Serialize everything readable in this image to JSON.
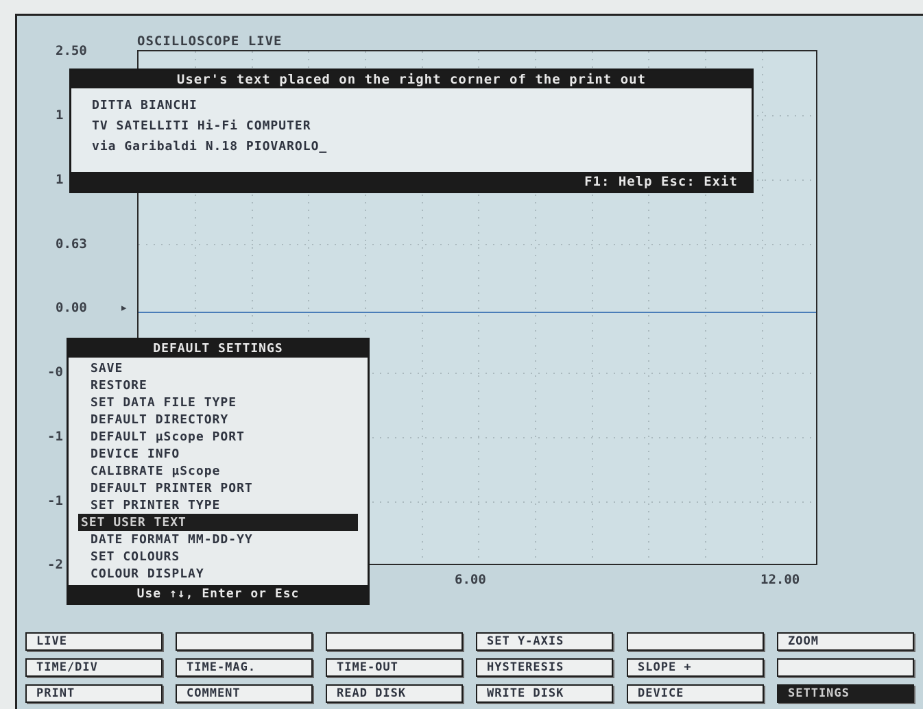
{
  "plot": {
    "title": "OSCILLOSCOPE LIVE",
    "y_labels": [
      {
        "key": "top",
        "text": "2.50"
      },
      {
        "key": "a",
        "text": "1"
      },
      {
        "key": "b",
        "text": "1"
      },
      {
        "key": "c",
        "text": "0.63"
      },
      {
        "key": "zero",
        "text": "0.00"
      },
      {
        "key": "d",
        "text": "-0"
      },
      {
        "key": "e",
        "text": "-1"
      },
      {
        "key": "f",
        "text": "-1"
      },
      {
        "key": "g",
        "text": "-2"
      }
    ],
    "x_labels": [
      "6.00",
      "12.00"
    ],
    "zero_marker": "▸"
  },
  "user_text_dialog": {
    "title": "User's text placed on the right corner of the print out",
    "lines": [
      "DITTA BIANCHI",
      "TV SATELLITI Hi-Fi COMPUTER",
      "via Garibaldi N.18 PIOVAROLO_"
    ],
    "footer": "F1: Help  Esc: Exit"
  },
  "settings_menu": {
    "title": "DEFAULT SETTINGS",
    "items": [
      "SAVE",
      "RESTORE",
      "SET DATA FILE TYPE",
      "DEFAULT DIRECTORY",
      "DEFAULT µScope PORT",
      "DEVICE INFO",
      "CALIBRATE µScope",
      "DEFAULT PRINTER PORT",
      "SET PRINTER TYPE",
      "SET USER TEXT",
      "DATE FORMAT MM-DD-YY",
      "SET COLOURS",
      "COLOUR DISPLAY"
    ],
    "selected_index": 9,
    "footer": "Use ↑↓, Enter or Esc"
  },
  "function_keys": {
    "rows": [
      [
        "LIVE",
        "",
        "",
        "SET Y-AXIS",
        "",
        "ZOOM"
      ],
      [
        "TIME/DIV",
        "TIME-MAG.",
        "TIME-OUT",
        "HYSTERESIS",
        "SLOPE +",
        ""
      ],
      [
        "PRINT",
        "COMMENT",
        "READ DISK",
        "WRITE DISK",
        "DEVICE",
        "SETTINGS"
      ]
    ],
    "active": "SETTINGS"
  },
  "colors": {
    "screen_bg": "#c5d6dc",
    "trace": "#4a7db8",
    "bar": "#1b1b1b"
  }
}
